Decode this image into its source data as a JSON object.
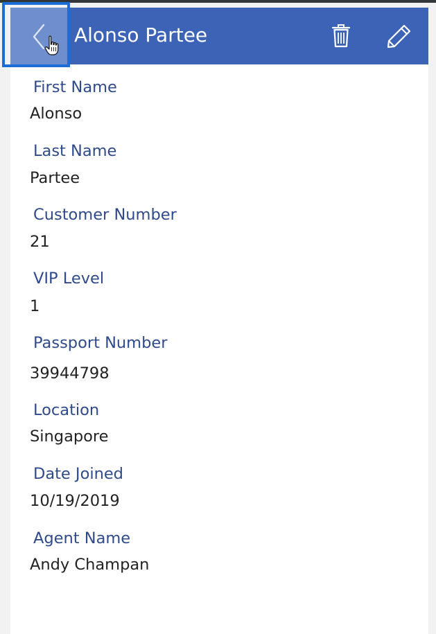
{
  "header": {
    "title": "Alonso Partee",
    "back_icon": "chevron-left-icon",
    "delete_icon": "trash-icon",
    "edit_icon": "pencil-icon",
    "color": "#3d63b7"
  },
  "fields": [
    {
      "label": "First Name",
      "value": "Alonso"
    },
    {
      "label": "Last Name",
      "value": "Partee"
    },
    {
      "label": "Customer Number",
      "value": "21"
    },
    {
      "label": "VIP Level",
      "value": "1"
    },
    {
      "label": "Passport Number",
      "value": "39944798"
    },
    {
      "label": "Location",
      "value": "Singapore"
    },
    {
      "label": "Date Joined",
      "value": "10/19/2019"
    },
    {
      "label": "Agent Name",
      "value": "Andy Champan"
    }
  ]
}
